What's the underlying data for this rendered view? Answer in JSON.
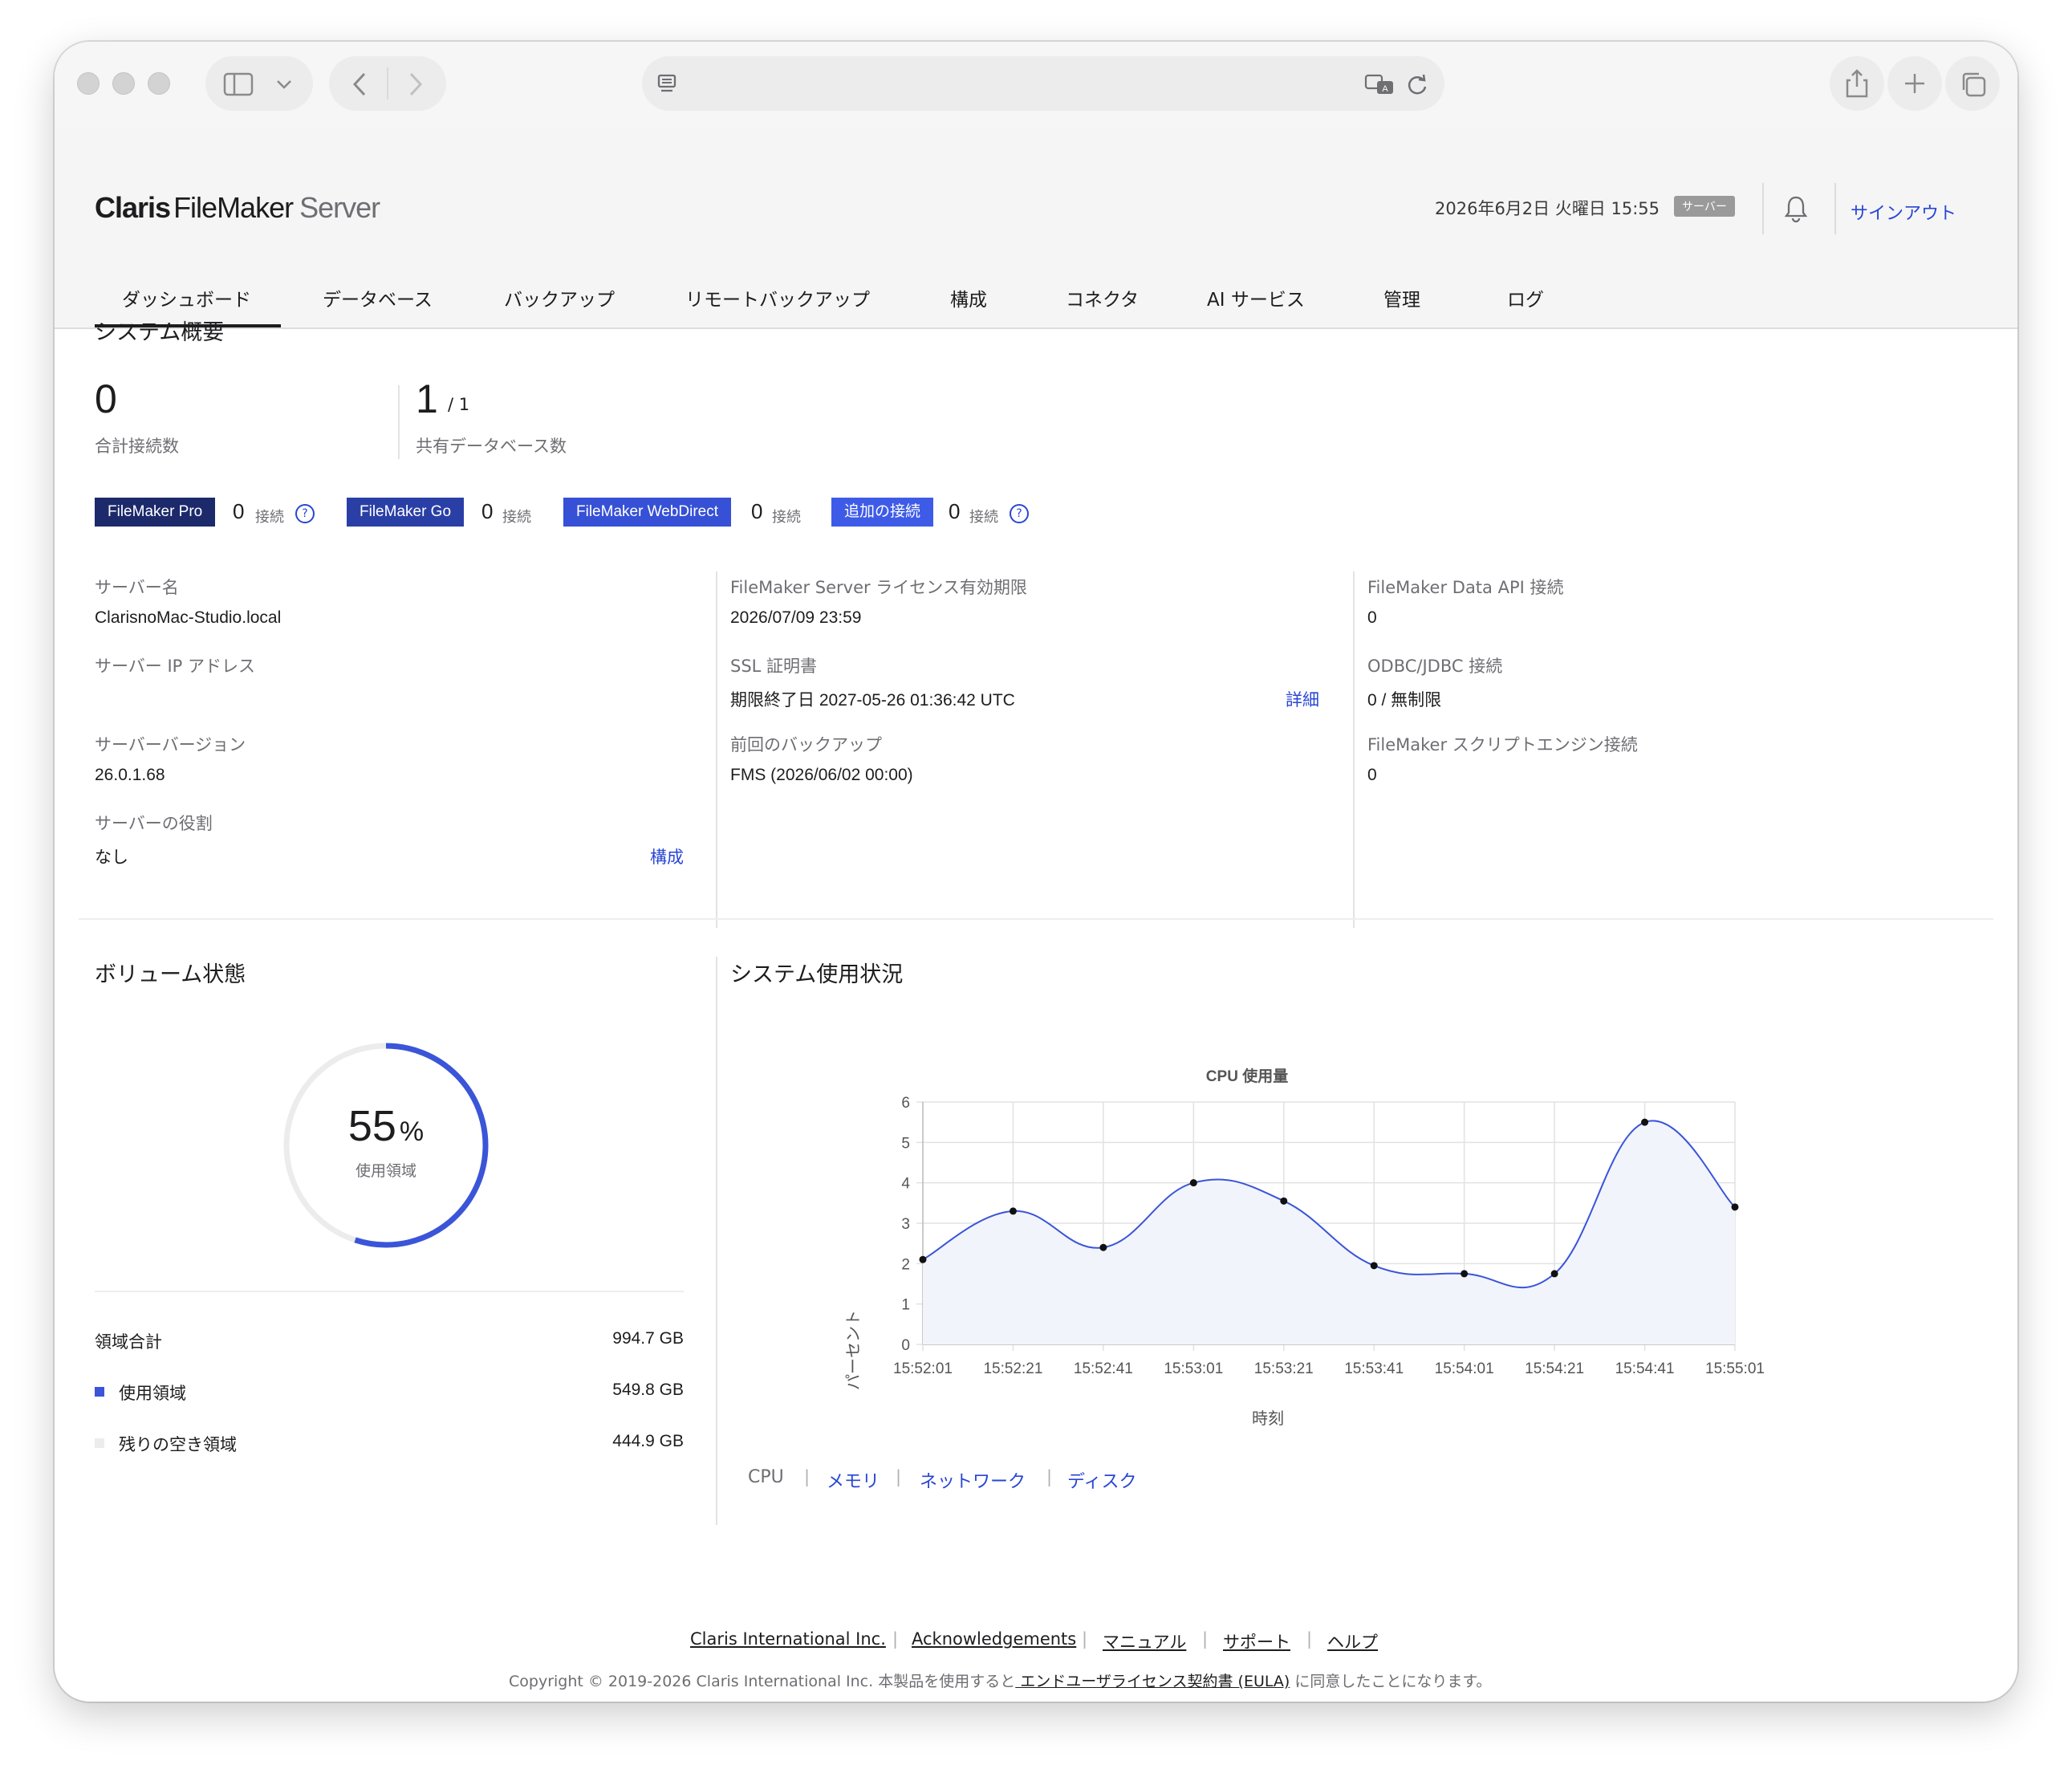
{
  "app": {
    "logo_claris": "Claris",
    "logo_filemaker": "FileMaker",
    "logo_server": "Server",
    "datetime": "2026年6月2日 火曜日 15:55",
    "role_badge": "サーバー",
    "signout": "サインアウト"
  },
  "tabs": [
    {
      "label": "ダッシュボード",
      "active": true
    },
    {
      "label": "データベース"
    },
    {
      "label": "バックアップ"
    },
    {
      "label": "リモートバックアップ"
    },
    {
      "label": "構成"
    },
    {
      "label": "コネクタ"
    },
    {
      "label": "AI サービス"
    },
    {
      "label": "管理"
    },
    {
      "label": "ログ"
    }
  ],
  "overview": {
    "title": "システム概要",
    "total_connections": "0",
    "total_connections_label": "合計接続数",
    "shared_db": "1",
    "shared_db_total": "/ 1",
    "shared_db_label": "共有データベース数"
  },
  "connections": [
    {
      "name": "FileMaker Pro",
      "count": "0",
      "unit": "接続",
      "color": "#1c2a6b",
      "help": true
    },
    {
      "name": "FileMaker Go",
      "count": "0",
      "unit": "接続",
      "color": "#2a3fa6"
    },
    {
      "name": "FileMaker WebDirect",
      "count": "0",
      "unit": "接続",
      "color": "#3650d6"
    },
    {
      "name": "追加の接続",
      "count": "0",
      "unit": "接続",
      "color": "#3e5be8",
      "help": true
    }
  ],
  "server_info": {
    "name_label": "サーバー名",
    "name": "ClarisnoMac-Studio.local",
    "ip_label": "サーバー IP アドレス",
    "ip": "",
    "version_label": "サーバーバージョン",
    "version": "26.0.1.68",
    "role_label": "サーバーの役割",
    "role": "なし",
    "config_link": "構成",
    "license_label": "FileMaker Server ライセンス有効期限",
    "license": "2026/07/09 23:59",
    "ssl_label": "SSL 証明書",
    "ssl": "期限終了日 2027-05-26 01:36:42 UTC",
    "ssl_detail_link": "詳細",
    "backup_label": "前回のバックアップ",
    "backup": "FMS (2026/06/02 00:00)",
    "dataapi_label": "FileMaker Data API 接続",
    "dataapi": "0",
    "odbc_label": "ODBC/JDBC 接続",
    "odbc": "0 / 無制限",
    "script_label": "FileMaker スクリプトエンジン接続",
    "script": "0"
  },
  "volume": {
    "title": "ボリューム状態",
    "percent": 55,
    "percent_text": "55",
    "percent_sign": "%",
    "used_label_center": "使用領域",
    "total_label": "領域合計",
    "total": "994.7 GB",
    "used_label": "使用領域",
    "used": "549.8 GB",
    "free_label": "残りの空き領域",
    "free": "444.9 GB",
    "used_color": "#3a55d8",
    "free_color": "#ececec"
  },
  "usage": {
    "title": "システム使用状況",
    "subtabs": [
      {
        "label": "CPU",
        "active": true
      },
      {
        "label": "メモリ"
      },
      {
        "label": "ネットワーク"
      },
      {
        "label": "ディスク"
      }
    ]
  },
  "chart_data": {
    "type": "line",
    "title": "CPU 使用量",
    "xlabel": "時刻",
    "ylabel": "パーセント",
    "x": [
      "15:52:01",
      "15:52:21",
      "15:52:41",
      "15:53:01",
      "15:53:21",
      "15:53:41",
      "15:54:01",
      "15:54:21",
      "15:54:41",
      "15:55:01"
    ],
    "series": [
      {
        "values": [
          2.1,
          3.3,
          2.4,
          4.0,
          3.55,
          1.95,
          1.75,
          1.75,
          5.5,
          3.4
        ]
      }
    ],
    "ylim": [
      0,
      6
    ],
    "yticks": [
      0,
      1,
      2,
      3,
      4,
      5,
      6
    ],
    "grid": true,
    "line_color": "#3a55d8"
  },
  "footer": {
    "links": [
      "Claris International Inc.",
      "Acknowledgements",
      "マニュアル",
      "サポート",
      "ヘルプ"
    ],
    "copyright_prefix": "Copyright © 2019-2026 Claris International Inc. 本製品を使用すると",
    "eula_link": " エンドユーザライセンス契約書 (EULA)",
    "copyright_suffix": " に同意したことになります。"
  }
}
